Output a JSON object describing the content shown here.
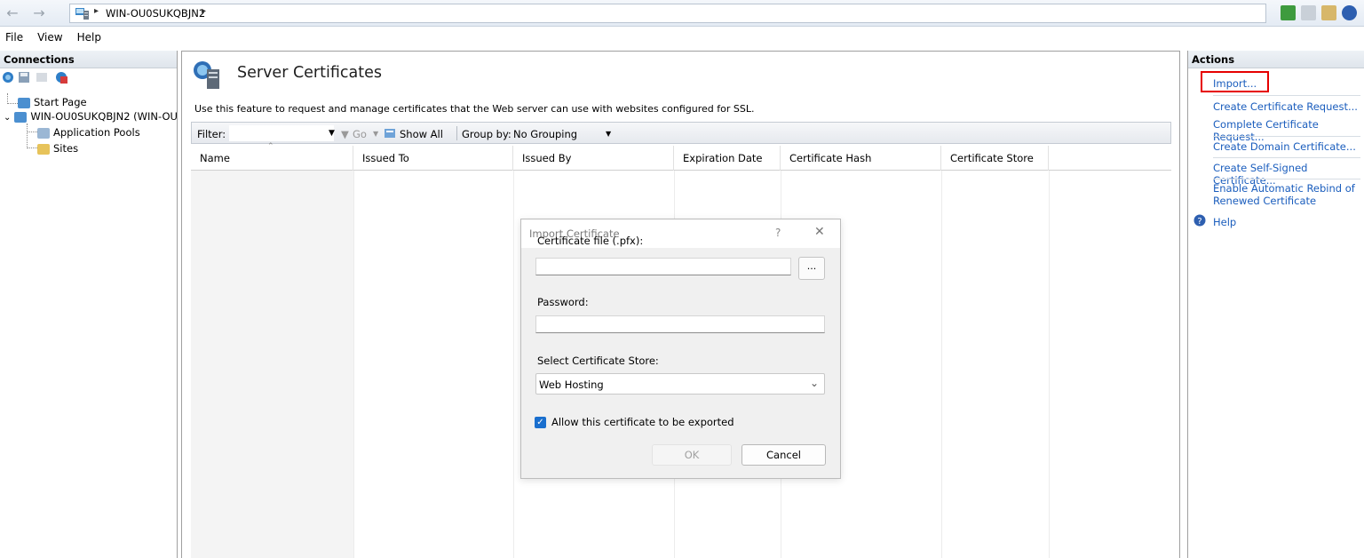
{
  "address": {
    "path": "WIN-OU0SUKQBJN2",
    "separator": "▸"
  },
  "menu": {
    "file": "File",
    "view": "View",
    "help": "Help"
  },
  "connections": {
    "title": "Connections",
    "tree": {
      "start_page": "Start Page",
      "server": "WIN-OU0SUKQBJN2 (WIN-OU",
      "app_pools": "Application Pools",
      "sites": "Sites"
    }
  },
  "feature": {
    "title": "Server Certificates",
    "description": "Use this feature to request and manage certificates that the Web server can use with websites configured for SSL."
  },
  "filterbar": {
    "filter_label": "Filter:",
    "go_label": "Go",
    "show_all_label": "Show All",
    "group_by_label": "Group by:",
    "group_by_value": "No Grouping"
  },
  "columns": [
    "Name",
    "Issued To",
    "Issued By",
    "Expiration Date",
    "Certificate Hash",
    "Certificate Store"
  ],
  "actions": {
    "title": "Actions",
    "import": "Import...",
    "create_request": "Create Certificate Request...",
    "complete_request": "Complete Certificate Request...",
    "create_domain": "Create Domain Certificate...",
    "create_self_signed": "Create Self-Signed Certificate...",
    "enable_rebind_1": "Enable Automatic Rebind of",
    "enable_rebind_2": "Renewed Certificate",
    "help": "Help",
    "highlight_color": "#e60000",
    "link_color": "#1a5dbd"
  },
  "dialog": {
    "title": "Import Certificate",
    "help_glyph": "?",
    "close_glyph": "✕",
    "file_label": "Certificate file (.pfx):",
    "file_value": "",
    "browse_label": "...",
    "password_label": "Password:",
    "password_value": "",
    "store_label": "Select Certificate Store:",
    "store_value": "Web Hosting",
    "allow_export_label": "Allow this certificate to be exported",
    "allow_export_checked": true,
    "ok_label": "OK",
    "cancel_label": "Cancel"
  }
}
